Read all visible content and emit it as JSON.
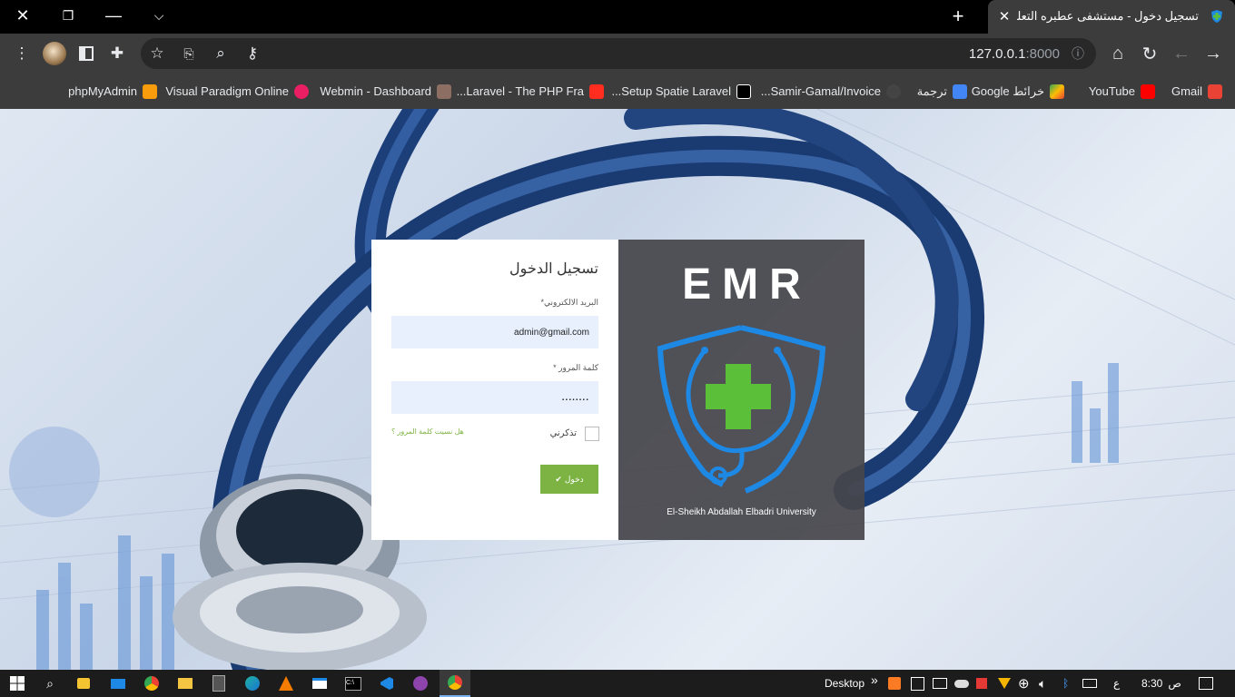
{
  "window": {
    "close_glyph": "✕",
    "restore_glyph": "❐",
    "minimize_glyph": "—",
    "tabsearch_glyph": "⌵"
  },
  "tab": {
    "title": "تسجيل دخول - مستشفى عطبره التعليمي",
    "close_glyph": "✕",
    "new_tab_glyph": "+"
  },
  "toolbar": {
    "url_host": "127.0.0.1",
    "url_port": ":8000",
    "menu_glyph": "⋮",
    "extensions_glyph": "✚",
    "bookmark_glyph": "☆",
    "home_glyph": "⌂",
    "reload_glyph": "↻",
    "back_glyph": "←",
    "forward_glyph": "→",
    "info_glyph": "ⓘ",
    "key_glyph": "⚷",
    "zoom_glyph": "⌕"
  },
  "bookmarks": [
    {
      "label": "Gmail",
      "icon": "gmail-icon",
      "color": "#ea4335"
    },
    {
      "label": "YouTube",
      "icon": "youtube-icon",
      "color": "#ff0000"
    },
    {
      "label": "خرائط Google",
      "icon": "maps-icon",
      "color": "#34a853"
    },
    {
      "label": "ترجمة",
      "icon": "translate-icon",
      "color": "#4285f4"
    },
    {
      "label": "Samir-Gamal/Invoice...",
      "icon": "github-icon",
      "color": "#ffffff"
    },
    {
      "label": "Setup Spatie Laravel...",
      "icon": "medium-icon",
      "color": "#ffffff"
    },
    {
      "label": "Laravel - The PHP Fra...",
      "icon": "laravel-icon",
      "color": "#ff2d20"
    },
    {
      "label": "Webmin - Dashboard",
      "icon": "webmin-icon",
      "color": "#8d6e63"
    },
    {
      "label": "Visual Paradigm Online",
      "icon": "visual-paradigm-icon",
      "color": "#e91e63"
    },
    {
      "label": "phpMyAdmin",
      "icon": "phpmyadmin-icon",
      "color": "#f89c0e"
    }
  ],
  "login": {
    "title": "تسجيل الدخول",
    "email_label": "البريد الالكتروني*",
    "email_value": "admin@gmail.com",
    "password_label": "كلمة المرور *",
    "password_value": "........",
    "remember_label": "تذكرني",
    "forgot_label": "هل نسيت كلمة المرور ؟",
    "submit_label": "دخول",
    "accent_color": "#7cb342"
  },
  "brand": {
    "title": "EMR",
    "subtitle": "El-Sheikh Abdallah Elbadri University",
    "logo_blue": "#1e88e5",
    "logo_green": "#5cbf3a"
  },
  "taskbar": {
    "desktop_label": "Desktop",
    "chevron": "»",
    "time": "8:30",
    "ampm": "ص",
    "lang": "ع"
  }
}
